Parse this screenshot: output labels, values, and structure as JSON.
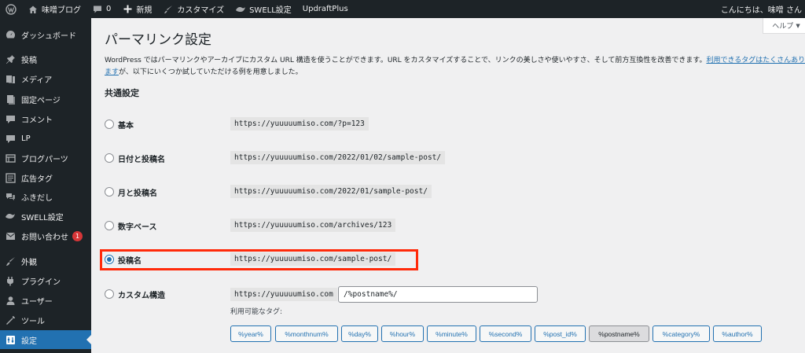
{
  "admin_bar": {
    "site_name": "味噌ブログ",
    "comments_count": "0",
    "new_label": "新規",
    "customize_label": "カスタマイズ",
    "swell_label": "SWELL設定",
    "updraft_label": "UpdraftPlus",
    "greeting": "こんにちは、味噌 さん"
  },
  "sidebar": {
    "items": [
      {
        "label": "ダッシュボード",
        "icon": "dashboard-icon"
      },
      {
        "label": "投稿",
        "icon": "pin-icon"
      },
      {
        "label": "メディア",
        "icon": "media-icon"
      },
      {
        "label": "固定ページ",
        "icon": "page-icon"
      },
      {
        "label": "コメント",
        "icon": "comment-icon"
      },
      {
        "label": "LP",
        "icon": "lp-icon"
      },
      {
        "label": "ブログパーツ",
        "icon": "parts-icon"
      },
      {
        "label": "広告タグ",
        "icon": "tag-icon"
      },
      {
        "label": "ふきだし",
        "icon": "balloon-icon"
      },
      {
        "label": "SWELL設定",
        "icon": "swell-icon"
      },
      {
        "label": "お問い合わせ",
        "icon": "mail-icon",
        "badge": "1"
      },
      {
        "label": "外観",
        "icon": "appearance-icon"
      },
      {
        "label": "プラグイン",
        "icon": "plugin-icon"
      },
      {
        "label": "ユーザー",
        "icon": "user-icon"
      },
      {
        "label": "ツール",
        "icon": "tool-icon"
      },
      {
        "label": "設定",
        "icon": "settings-icon",
        "current": true
      }
    ]
  },
  "help_label": "ヘルプ",
  "page_title": "パーマリンク設定",
  "intro": {
    "text1": "WordPress ではパーマリンクやアーカイブにカスタム URL 構造を使うことができます。URL をカスタマイズすることで、リンクの美しさや使いやすさ、そして前方互換性を改善できます。",
    "link": "利用できるタグはたくさんあります",
    "text2": "が、以下にいくつか試していただける例を用意しました。"
  },
  "section_title": "共通設定",
  "options": [
    {
      "label": "基本",
      "url": "https://yuuuuumiso.com/?p=123",
      "checked": false
    },
    {
      "label": "日付と投稿名",
      "url": "https://yuuuuumiso.com/2022/01/02/sample-post/",
      "checked": false
    },
    {
      "label": "月と投稿名",
      "url": "https://yuuuuumiso.com/2022/01/sample-post/",
      "checked": false
    },
    {
      "label": "数字ベース",
      "url": "https://yuuuuumiso.com/archives/123",
      "checked": false
    },
    {
      "label": "投稿名",
      "url": "https://yuuuuumiso.com/sample-post/",
      "checked": true
    },
    {
      "label": "カスタム構造",
      "url": "https://yuuuuumiso.com",
      "checked": false
    }
  ],
  "custom_structure_value": "/%postname%/",
  "available_tags_label": "利用可能なタグ:",
  "tags": [
    "%year%",
    "%monthnum%",
    "%day%",
    "%hour%",
    "%minute%",
    "%second%",
    "%post_id%",
    "%postname%",
    "%category%",
    "%author%"
  ],
  "active_tag": "%postname%",
  "colors": {
    "accent": "#2271b1",
    "highlight": "#ff2a0a",
    "admin_dark": "#1d2327"
  }
}
